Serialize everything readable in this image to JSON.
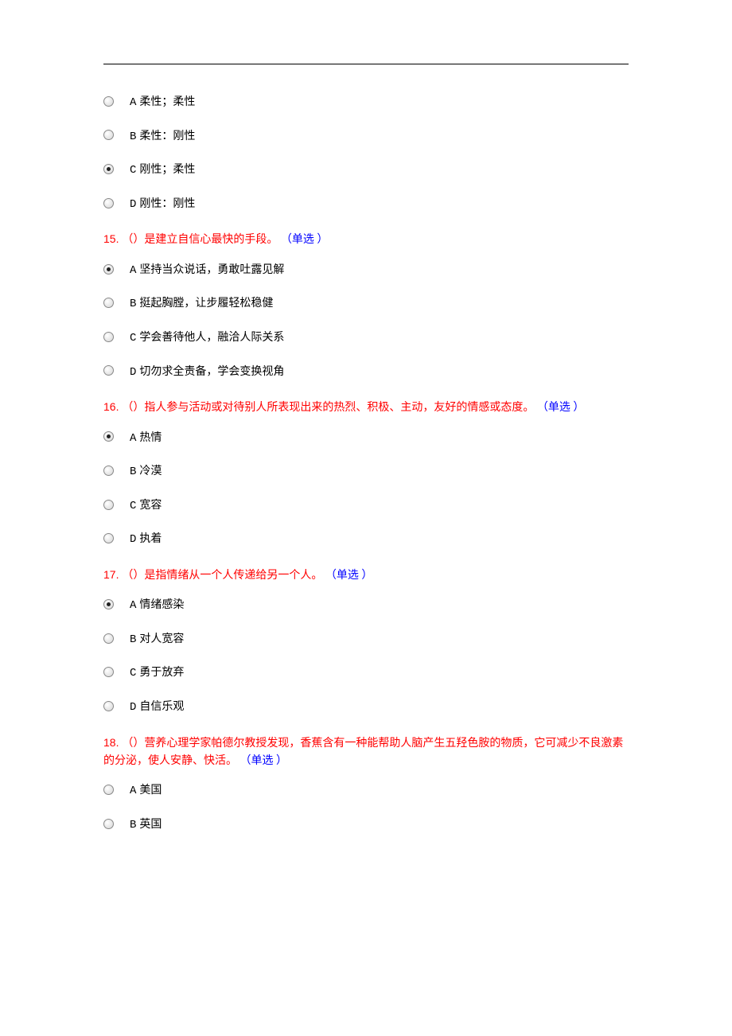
{
  "q14": {
    "options": [
      {
        "letter": "A",
        "text": "柔性；柔性",
        "selected": false
      },
      {
        "letter": "B",
        "text": "柔性：刚性",
        "selected": false
      },
      {
        "letter": "C",
        "text": "刚性；柔性",
        "selected": true
      },
      {
        "letter": "D",
        "text": "刚性：刚性",
        "selected": false
      }
    ]
  },
  "q15": {
    "number": "15.  ",
    "text": "（）是建立自信心最快的手段。 ",
    "type": "（单选 ）",
    "options": [
      {
        "letter": "A",
        "text": "坚持当众说话，勇敢吐露见解",
        "selected": true
      },
      {
        "letter": "B",
        "text": "挺起胸膛，让步履轻松稳健",
        "selected": false
      },
      {
        "letter": "C",
        "text": "学会善待他人，融洽人际关系",
        "selected": false
      },
      {
        "letter": "D",
        "text": "切勿求全责备，学会变换视角",
        "selected": false
      }
    ]
  },
  "q16": {
    "number": "16.  ",
    "text": "（）指人参与活动或对待别人所表现出来的热烈、积极、主动，友好的情感或态度。 ",
    "type": "（单选 ）",
    "options": [
      {
        "letter": "A",
        "text": "热情",
        "selected": true
      },
      {
        "letter": "B",
        "text": "冷漠",
        "selected": false
      },
      {
        "letter": "C",
        "text": "宽容",
        "selected": false
      },
      {
        "letter": "D",
        "text": "执着",
        "selected": false
      }
    ]
  },
  "q17": {
    "number": "17.  ",
    "text": "（）是指情绪从一个人传递给另一个人。 ",
    "type": "（单选 ）",
    "options": [
      {
        "letter": "A",
        "text": "情绪感染",
        "selected": true
      },
      {
        "letter": "B",
        "text": "对人宽容",
        "selected": false
      },
      {
        "letter": "C",
        "text": "勇于放弃",
        "selected": false
      },
      {
        "letter": "D",
        "text": "自信乐观",
        "selected": false
      }
    ]
  },
  "q18": {
    "number": "18.  ",
    "text": "（）营养心理学家帕德尔教授发现，香蕉含有一种能帮助人脑产生五羟色胺的物质，它可减少不良激素的分泌，使人安静、快活。 ",
    "type": "（单选 ）",
    "options": [
      {
        "letter": "A",
        "text": "美国",
        "selected": false
      },
      {
        "letter": "B",
        "text": "英国",
        "selected": false
      }
    ]
  }
}
